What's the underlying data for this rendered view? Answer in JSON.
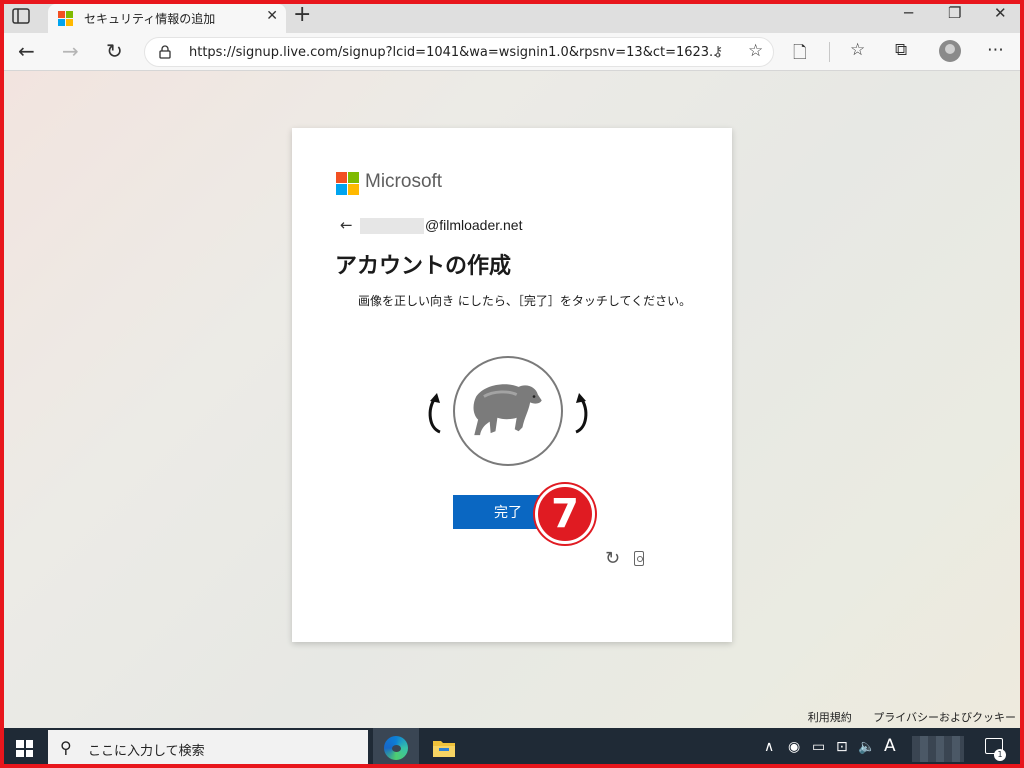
{
  "browser": {
    "tab": {
      "title": "セキュリティ情報の追加",
      "close": "✕"
    },
    "new_tab": "+",
    "window_controls": {
      "minimize": "─",
      "restore": "❐",
      "close": "✕"
    },
    "url": "https://signup.live.com/signup?lcid=1041&wa=wsignin1.0&rpsnv=13&ct=1623...",
    "icons": [
      "back-icon",
      "forward-icon",
      "refresh-icon",
      "lock-icon",
      "key-icon",
      "add-favorite-icon",
      "reading-view-icon",
      "favorites-icon",
      "collections-icon",
      "profile-icon",
      "more-icon"
    ]
  },
  "signup": {
    "brand": "Microsoft",
    "brand_colors": [
      "#f25022",
      "#7fba00",
      "#00a4ef",
      "#ffb900"
    ],
    "email": "@filmloader.net",
    "heading": "アカウントの作成",
    "instruction": "画像を正しい向き にしたら、［完了］をタッチしてください。",
    "done_button": "完了",
    "accent": "#0a67c2",
    "step_badge": "7"
  },
  "footer": {
    "terms": "利用規約",
    "privacy": "プライバシーおよびクッキー"
  },
  "taskbar": {
    "search_placeholder": "ここに入力して検索",
    "ime": "A",
    "notification_count": "1"
  }
}
